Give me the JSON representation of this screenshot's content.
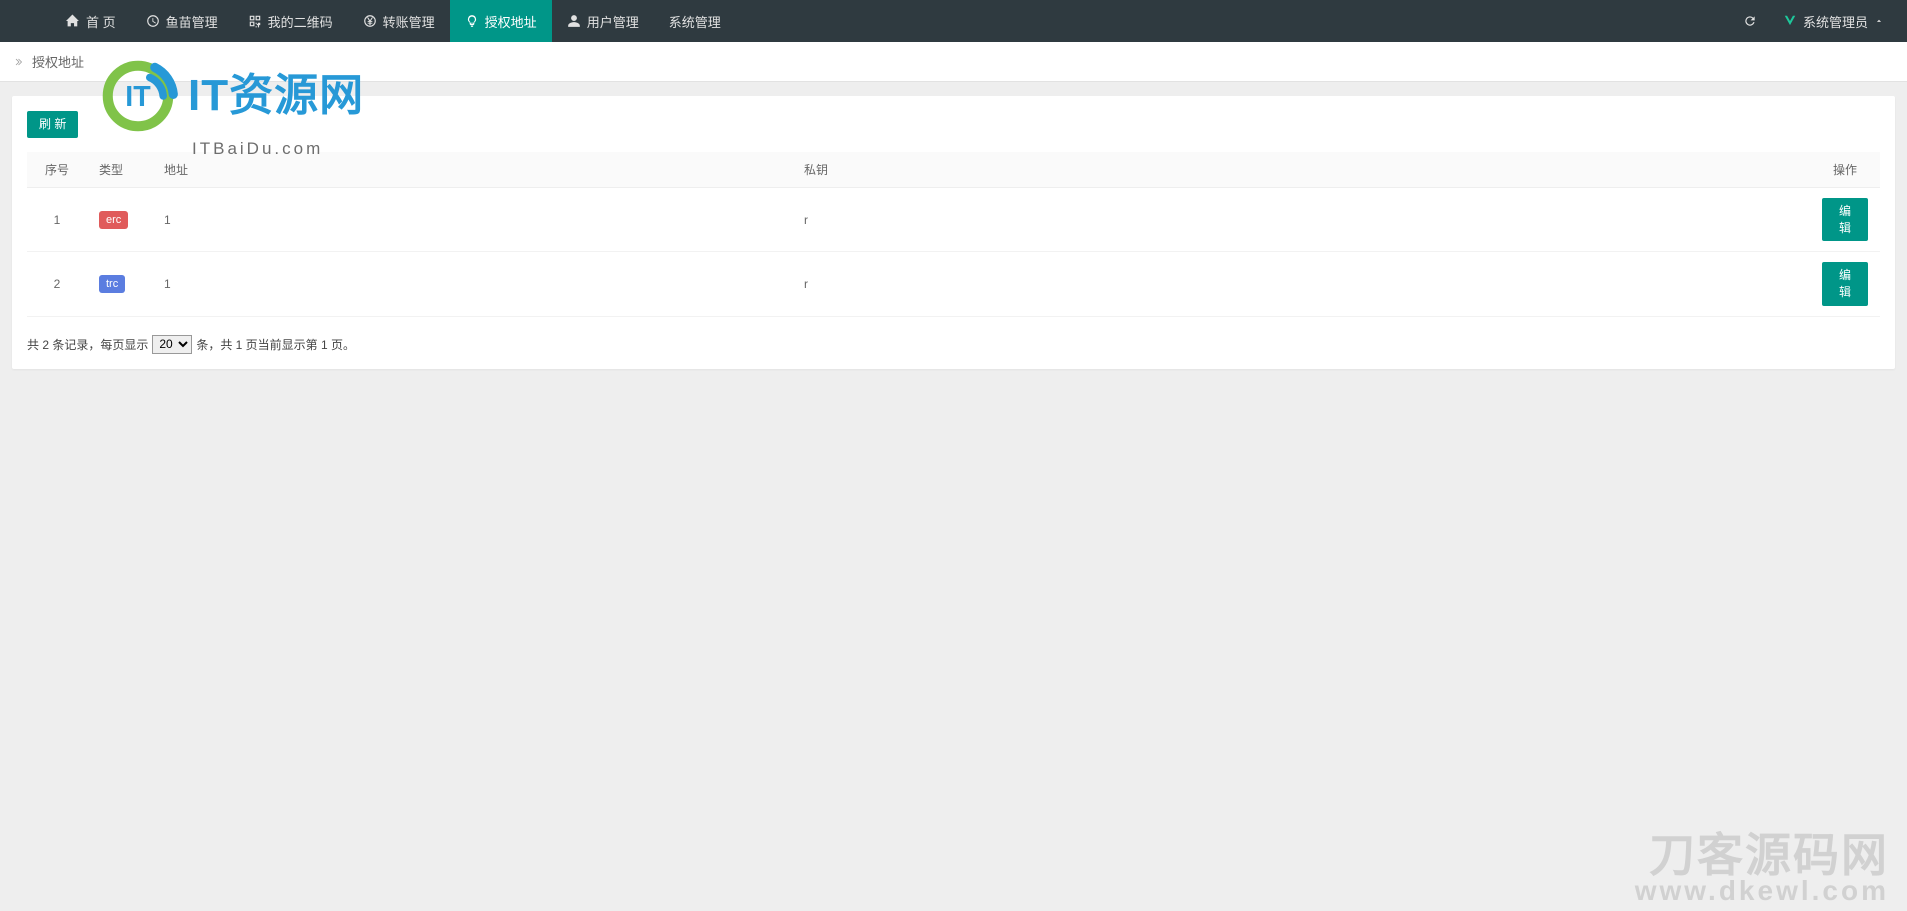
{
  "nav": {
    "items": [
      {
        "label": "首 页",
        "icon": "home"
      },
      {
        "label": "鱼苗管理",
        "icon": "clock"
      },
      {
        "label": "我的二维码",
        "icon": "qrcode"
      },
      {
        "label": "转账管理",
        "icon": "yen"
      },
      {
        "label": "授权地址",
        "icon": "bulb",
        "active": true
      },
      {
        "label": "用户管理",
        "icon": "user"
      },
      {
        "label": "系统管理",
        "icon": ""
      }
    ],
    "user_label": "系统管理员"
  },
  "breadcrumb": {
    "current": "授权地址"
  },
  "toolbar": {
    "refresh_label": "刷 新"
  },
  "table": {
    "headers": {
      "seq": "序号",
      "type": "类型",
      "address": "地址",
      "private_key": "私钥",
      "op": "操作"
    },
    "rows": [
      {
        "seq": "1",
        "type_label": "erc",
        "type_color": "red",
        "address": "1",
        "key": "r",
        "edit_label": "编辑"
      },
      {
        "seq": "2",
        "type_label": "trc",
        "type_color": "blue",
        "address": "1",
        "key": "r",
        "edit_label": "编辑"
      }
    ]
  },
  "pagination": {
    "prefix": "共 2 条记录，每页显示",
    "page_size": "20",
    "suffix": "条，共 1 页当前显示第 1 页。"
  },
  "watermarks": {
    "top_brand": "IT资源网",
    "top_sub": "ITBaiDu.com",
    "bottom_line1": "刀客源码网",
    "bottom_line2": "www.dkewl.com"
  }
}
